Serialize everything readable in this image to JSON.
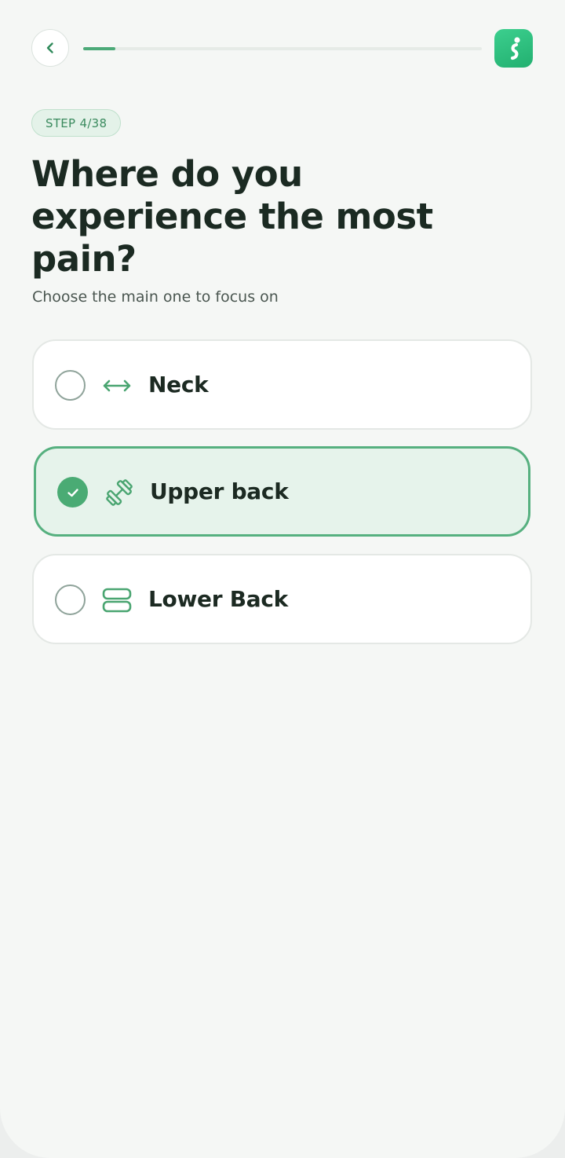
{
  "header": {
    "back_icon": "chevron-left-icon",
    "progress": 0.08,
    "logo_icon": "app-logo-icon",
    "accent_color": "#4caa78"
  },
  "step_badge": "STEP 4/38",
  "title": "Where do you experience the most pain?",
  "subtitle": "Choose the main one to focus on",
  "options": [
    {
      "label": "Neck",
      "icon": "horizontal-arrows-icon",
      "selected": false
    },
    {
      "label": "Upper back",
      "icon": "dumbbell-icon",
      "selected": true
    },
    {
      "label": "Lower Back",
      "icon": "stacked-bars-icon",
      "selected": false
    }
  ]
}
